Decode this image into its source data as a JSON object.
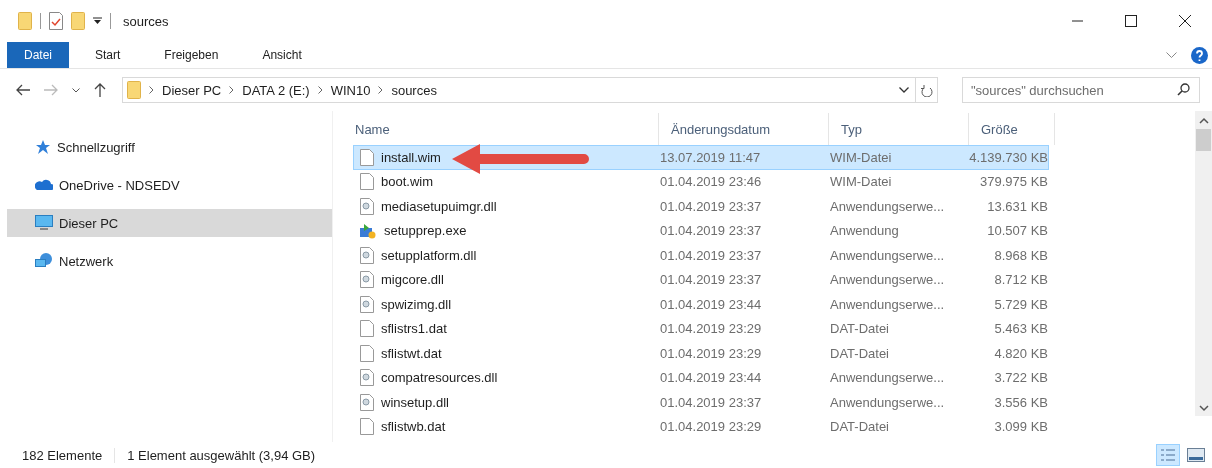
{
  "window": {
    "title": "sources"
  },
  "ribbon_tabs": [
    {
      "label": "Datei",
      "selected": true
    },
    {
      "label": "Start",
      "selected": false
    },
    {
      "label": "Freigeben",
      "selected": false
    },
    {
      "label": "Ansicht",
      "selected": false
    }
  ],
  "address": {
    "crumbs": [
      "Dieser PC",
      "DATA 2 (E:)",
      "WIN10",
      "sources"
    ]
  },
  "search": {
    "placeholder": "\"sources\" durchsuchen"
  },
  "sidebar": {
    "items": [
      {
        "label": "Schnellzugriff",
        "kind": "star",
        "selected": false
      },
      {
        "label": "OneDrive - NDSEDV",
        "kind": "cloud",
        "selected": false
      },
      {
        "label": "Dieser PC",
        "kind": "pc",
        "selected": true
      },
      {
        "label": "Netzwerk",
        "kind": "network",
        "selected": false
      }
    ]
  },
  "table": {
    "columns": [
      "Name",
      "Änderungsdatum",
      "Typ",
      "Größe"
    ],
    "rows": [
      {
        "name": "install.wim",
        "date": "13.07.2019 11:47",
        "type": "WIM-Datei",
        "size": "4.139.730 KB",
        "kind": "file",
        "selected": true
      },
      {
        "name": "boot.wim",
        "date": "01.04.2019 23:46",
        "type": "WIM-Datei",
        "size": "379.975 KB",
        "kind": "file",
        "selected": false
      },
      {
        "name": "mediasetupuimgr.dll",
        "date": "01.04.2019 23:37",
        "type": "Anwendungserwe...",
        "size": "13.631 KB",
        "kind": "dll",
        "selected": false
      },
      {
        "name": "setupprep.exe",
        "date": "01.04.2019 23:37",
        "type": "Anwendung",
        "size": "10.507 KB",
        "kind": "exe",
        "selected": false
      },
      {
        "name": "setupplatform.dll",
        "date": "01.04.2019 23:37",
        "type": "Anwendungserwe...",
        "size": "8.968 KB",
        "kind": "dll",
        "selected": false
      },
      {
        "name": "migcore.dll",
        "date": "01.04.2019 23:37",
        "type": "Anwendungserwe...",
        "size": "8.712 KB",
        "kind": "dll",
        "selected": false
      },
      {
        "name": "spwizimg.dll",
        "date": "01.04.2019 23:44",
        "type": "Anwendungserwe...",
        "size": "5.729 KB",
        "kind": "dll",
        "selected": false
      },
      {
        "name": "sflistrs1.dat",
        "date": "01.04.2019 23:29",
        "type": "DAT-Datei",
        "size": "5.463 KB",
        "kind": "file",
        "selected": false
      },
      {
        "name": "sflistwt.dat",
        "date": "01.04.2019 23:29",
        "type": "DAT-Datei",
        "size": "4.820 KB",
        "kind": "file",
        "selected": false
      },
      {
        "name": "compatresources.dll",
        "date": "01.04.2019 23:44",
        "type": "Anwendungserwe...",
        "size": "3.722 KB",
        "kind": "dll",
        "selected": false
      },
      {
        "name": "winsetup.dll",
        "date": "01.04.2019 23:37",
        "type": "Anwendungserwe...",
        "size": "3.556 KB",
        "kind": "dll",
        "selected": false
      },
      {
        "name": "sflistwb.dat",
        "date": "01.04.2019 23:29",
        "type": "DAT-Datei",
        "size": "3.099 KB",
        "kind": "file",
        "selected": false
      }
    ]
  },
  "status_bar": {
    "count": "182 Elemente",
    "selection": "1 Element ausgewählt (3,94 GB)"
  },
  "views": [
    {
      "kind": "details",
      "selected": true
    },
    {
      "kind": "tiles",
      "selected": false
    }
  ]
}
